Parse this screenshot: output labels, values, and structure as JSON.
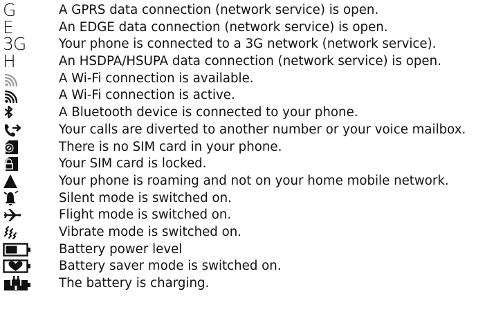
{
  "legend": {
    "items": [
      {
        "icon": "gprs-icon",
        "glyph": "G",
        "text": "A GPRS data connection (network service) is open."
      },
      {
        "icon": "edge-icon",
        "glyph": "E",
        "text": "An EDGE data connection (network service) is open."
      },
      {
        "icon": "3g-icon",
        "glyph": "3G",
        "text": "Your phone is connected to a 3G network (network service)."
      },
      {
        "icon": "hsdpa-icon",
        "glyph": "H",
        "text": "An HSDPA/HSUPA data connection (network service) is open."
      },
      {
        "icon": "wifi-available-icon",
        "text": "A Wi-Fi connection is available."
      },
      {
        "icon": "wifi-active-icon",
        "text": "A Wi-Fi connection is active."
      },
      {
        "icon": "bluetooth-icon",
        "text": "A Bluetooth device is connected to your phone."
      },
      {
        "icon": "call-divert-icon",
        "text": "Your calls are diverted to another number or your voice mailbox."
      },
      {
        "icon": "no-sim-icon",
        "text": "There is no SIM card in your phone."
      },
      {
        "icon": "sim-locked-icon",
        "text": "Your SIM card is locked."
      },
      {
        "icon": "roaming-icon",
        "text": "Your phone is roaming and not on your home mobile network."
      },
      {
        "icon": "silent-mode-icon",
        "text": "Silent mode is switched on."
      },
      {
        "icon": "flight-mode-icon",
        "text": "Flight mode is switched on."
      },
      {
        "icon": "vibrate-icon",
        "text": "Vibrate mode is switched on."
      },
      {
        "icon": "battery-level-icon",
        "text": "Battery power level"
      },
      {
        "icon": "battery-saver-icon",
        "text": "Battery saver mode is switched on."
      },
      {
        "icon": "battery-charging-icon",
        "text": "The battery is charging."
      }
    ]
  }
}
